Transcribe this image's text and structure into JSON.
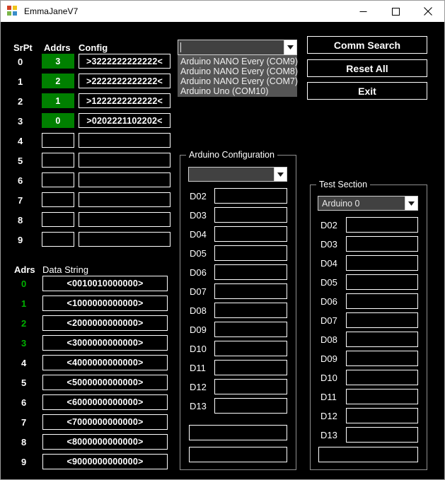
{
  "window": {
    "title": "EmmaJaneV7",
    "icon": "app-icon",
    "minimize_label": "─",
    "maximize_label": "□",
    "close_label": "✕"
  },
  "srpt_table": {
    "headers": {
      "srpt": "SrPt",
      "addrs": "Addrs",
      "config": "Config"
    },
    "rows": [
      {
        "srpt": "0",
        "addrs": "3",
        "addrs_filled": true,
        "config": ">3222222222222<"
      },
      {
        "srpt": "1",
        "addrs": "2",
        "addrs_filled": true,
        "config": ">2222222222222<"
      },
      {
        "srpt": "2",
        "addrs": "1",
        "addrs_filled": true,
        "config": ">1222222222222<"
      },
      {
        "srpt": "3",
        "addrs": "0",
        "addrs_filled": true,
        "config": ">0202221102202<"
      },
      {
        "srpt": "4",
        "addrs": "",
        "addrs_filled": false,
        "config": ""
      },
      {
        "srpt": "5",
        "addrs": "",
        "addrs_filled": false,
        "config": ""
      },
      {
        "srpt": "6",
        "addrs": "",
        "addrs_filled": false,
        "config": ""
      },
      {
        "srpt": "7",
        "addrs": "",
        "addrs_filled": false,
        "config": ""
      },
      {
        "srpt": "8",
        "addrs": "",
        "addrs_filled": false,
        "config": ""
      },
      {
        "srpt": "9",
        "addrs": "",
        "addrs_filled": false,
        "config": ""
      }
    ]
  },
  "data_string_table": {
    "headers": {
      "adrs": "Adrs",
      "data_string": "Data String"
    },
    "rows": [
      {
        "adrs": "0",
        "highlight": true,
        "value": "<0010010000000>"
      },
      {
        "adrs": "1",
        "highlight": true,
        "value": "<1000000000000>"
      },
      {
        "adrs": "2",
        "highlight": true,
        "value": "<2000000000000>"
      },
      {
        "adrs": "3",
        "highlight": true,
        "value": "<3000000000000>"
      },
      {
        "adrs": "4",
        "highlight": false,
        "value": "<4000000000000>"
      },
      {
        "adrs": "5",
        "highlight": false,
        "value": "<5000000000000>"
      },
      {
        "adrs": "6",
        "highlight": false,
        "value": "<6000000000000>"
      },
      {
        "adrs": "7",
        "highlight": false,
        "value": "<7000000000000>"
      },
      {
        "adrs": "8",
        "highlight": false,
        "value": "<8000000000000>"
      },
      {
        "adrs": "9",
        "highlight": false,
        "value": "<9000000000000>"
      }
    ]
  },
  "comm_port": {
    "selected": "",
    "placeholder": "",
    "arrow_icon": "chevron-down-icon",
    "options": [
      "Arduino NANO Every (COM9)",
      "Arduino NANO Every (COM8)",
      "Arduino NANO Every (COM7)",
      "Arduino Uno (COM10)"
    ]
  },
  "buttons": {
    "comm_search": "Comm Search",
    "reset_all": "Reset All",
    "exit": "Exit"
  },
  "arduino_configuration": {
    "title": "Arduino Configuration",
    "combo": {
      "selected": "",
      "arrow_icon": "chevron-down-icon"
    },
    "pins": [
      {
        "label": "D02",
        "value": ""
      },
      {
        "label": "D03",
        "value": ""
      },
      {
        "label": "D04",
        "value": ""
      },
      {
        "label": "D05",
        "value": ""
      },
      {
        "label": "D06",
        "value": ""
      },
      {
        "label": "D07",
        "value": ""
      },
      {
        "label": "D08",
        "value": ""
      },
      {
        "label": "D09",
        "value": ""
      },
      {
        "label": "D10",
        "value": ""
      },
      {
        "label": "D11",
        "value": ""
      },
      {
        "label": "D12",
        "value": ""
      },
      {
        "label": "D13",
        "value": ""
      }
    ],
    "extra_fields": [
      {
        "value": ""
      },
      {
        "value": ""
      }
    ]
  },
  "test_section": {
    "title": "Test Section",
    "combo": {
      "selected": "Arduino 0",
      "arrow_icon": "chevron-down-icon"
    },
    "pins": [
      {
        "label": "D02",
        "value": ""
      },
      {
        "label": "D03",
        "value": ""
      },
      {
        "label": "D04",
        "value": ""
      },
      {
        "label": "D05",
        "value": ""
      },
      {
        "label": "D06",
        "value": ""
      },
      {
        "label": "D07",
        "value": ""
      },
      {
        "label": "D08",
        "value": ""
      },
      {
        "label": "D09",
        "value": ""
      },
      {
        "label": "D10",
        "value": ""
      },
      {
        "label": "D11",
        "value": ""
      },
      {
        "label": "D12",
        "value": ""
      },
      {
        "label": "D13",
        "value": ""
      }
    ],
    "extra_fields": [
      {
        "value": ""
      }
    ]
  },
  "colors": {
    "background": "#000000",
    "foreground": "#ffffff",
    "accent_green": "#008000",
    "label_green": "#00b000",
    "groupbox_border": "#8f8f8f",
    "combo_fill": "#414141",
    "dropdown_fill": "#555555"
  }
}
